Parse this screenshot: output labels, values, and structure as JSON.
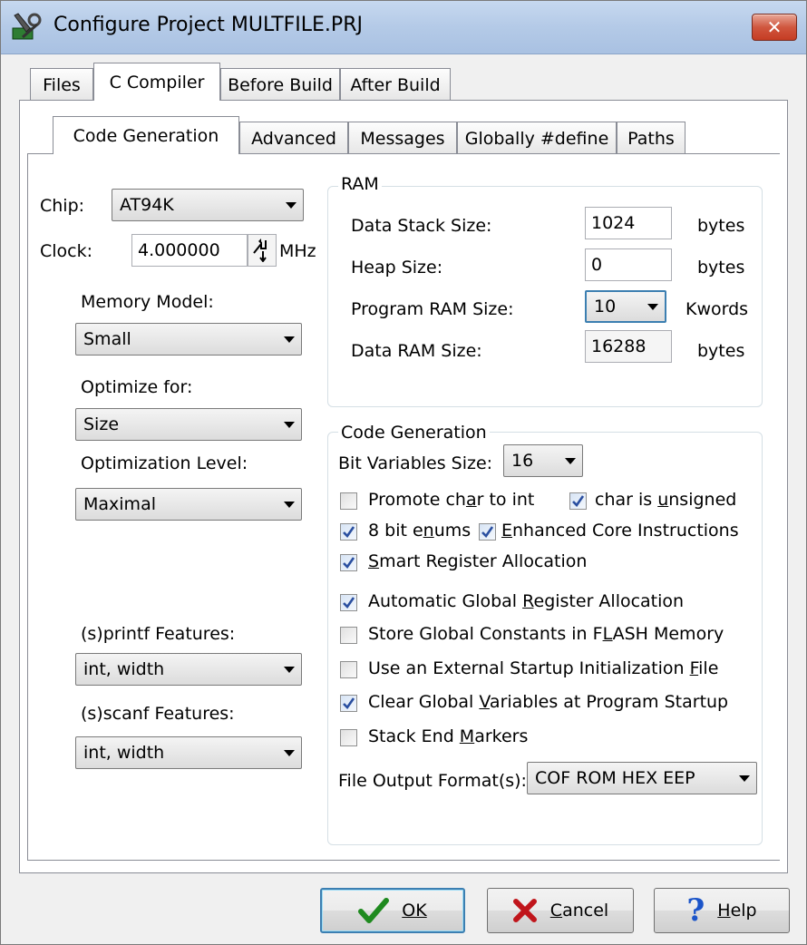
{
  "window": {
    "title": "Configure Project MULTFILE.PRJ",
    "close": "✕"
  },
  "tabs": [
    "Files",
    "C Compiler",
    "Before Build",
    "After Build"
  ],
  "subtabs": [
    "Code Generation",
    "Advanced",
    "Messages",
    "Globally #define",
    "Paths"
  ],
  "left": {
    "chip_label": "Chip:",
    "chip_value": "AT94K",
    "clock_label": "Clock:",
    "clock_value": "4.000000",
    "clock_unit": "MHz",
    "memory_model_label": "Memory Model:",
    "memory_model_value": "Small",
    "optimize_for_label": "Optimize for:",
    "optimize_for_value": "Size",
    "opt_level_label": "Optimization Level:",
    "opt_level_value": "Maximal",
    "printf_label": "(s)printf Features:",
    "printf_value": "int, width",
    "scanf_label": "(s)scanf Features:",
    "scanf_value": "int, width"
  },
  "ram": {
    "title": "RAM",
    "rows": [
      {
        "label": "Data Stack Size:",
        "value": "1024",
        "unit": "bytes"
      },
      {
        "label": "Heap Size:",
        "value": "0",
        "unit": "bytes"
      },
      {
        "label": "Program RAM Size:",
        "value": "10",
        "unit": "Kwords"
      },
      {
        "label": "Data RAM Size:",
        "value": "16288",
        "unit": "bytes"
      }
    ]
  },
  "codegen": {
    "title": "Code Generation",
    "bitvar_label": "Bit Variables Size:",
    "bitvar_value": "16",
    "file_output_label": "File Output Format(s):",
    "file_output_value": "COF ROM HEX EEP"
  },
  "checkboxes": {
    "promote": {
      "checked": false
    },
    "unsigned": {
      "checked": true
    },
    "enums8": {
      "checked": true
    },
    "enhanced": {
      "checked": true
    },
    "smart": {
      "checked": true
    },
    "autoglobal": {
      "checked": true
    },
    "flash": {
      "checked": false
    },
    "external": {
      "checked": false
    },
    "clearglobal": {
      "checked": true
    },
    "stackend": {
      "checked": false
    }
  },
  "buttons": {
    "ok": "OK",
    "cancel": "Cancel",
    "help": "Help"
  }
}
